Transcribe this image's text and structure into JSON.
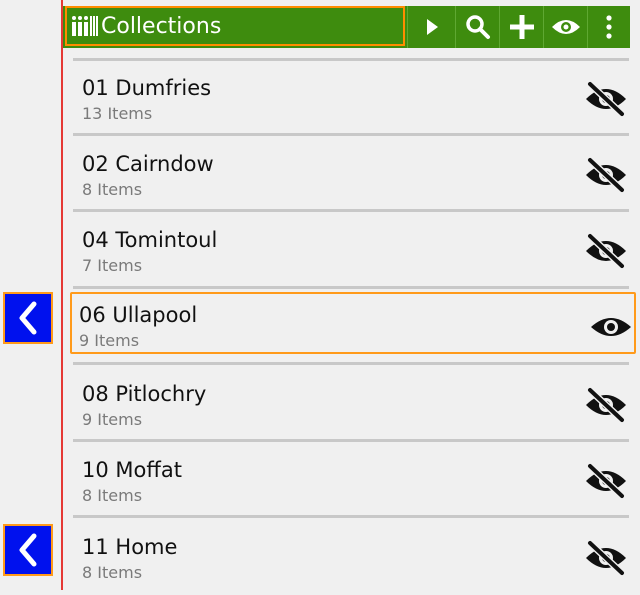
{
  "toolbar": {
    "title": "Collections",
    "title_icon": "library-icon",
    "buttons": [
      "play-icon",
      "search-icon",
      "add-icon",
      "eye-icon",
      "more-vert-icon"
    ],
    "background": "#3e8c0e",
    "highlight": "#ff8c00"
  },
  "collections": [
    {
      "name": "01 Dumfries",
      "count": "13 Items",
      "visible": false
    },
    {
      "name": "02 Cairndow",
      "count": "8 Items",
      "visible": false
    },
    {
      "name": "04 Tomintoul",
      "count": "7 Items",
      "visible": false
    },
    {
      "name": "06 Ullapool",
      "count": "9 Items",
      "visible": true,
      "selected": true
    },
    {
      "name": "08 Pitlochry",
      "count": "9 Items",
      "visible": false
    },
    {
      "name": "10 Moffat",
      "count": "8 Items",
      "visible": false
    },
    {
      "name": "11 Home",
      "count": "8 Items",
      "visible": false
    }
  ],
  "side_buttons": [
    "chevron-left-icon",
    "chevron-left-icon"
  ],
  "colors": {
    "accent_blue": "#0011ee",
    "divider_red": "#e53935"
  }
}
